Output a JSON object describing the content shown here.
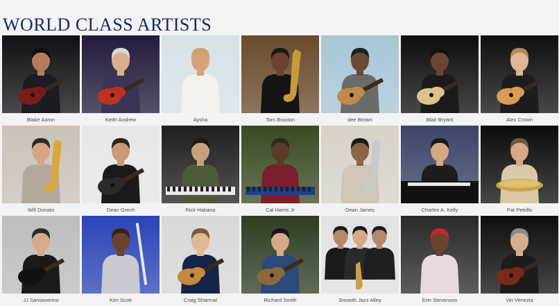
{
  "page": {
    "title": "WORLD CLASS ARTISTS"
  },
  "artists": [
    {
      "name": "Blake Aaron",
      "bg": "#111014",
      "shirt": "#1c1c22",
      "skin": "#b57d5a",
      "hair": "#111111",
      "prop": "guitar",
      "accent": "#7a1d1a"
    },
    {
      "name": "Keith Andrew",
      "bg": "#241a3d",
      "shirt": "#3a3456",
      "skin": "#d9b08d",
      "hair": "#d8d8d8",
      "prop": "guitar",
      "accent": "#c0301f"
    },
    {
      "name": "Aysha",
      "bg": "#d7e2e8",
      "shirt": "#f4f1ec",
      "skin": "#d6a27b",
      "hair": "#c9a56b",
      "prop": "none",
      "accent": "#f4f1ec"
    },
    {
      "name": "Tom Braxton",
      "bg": "#6a4a2c",
      "shirt": "#141414",
      "skin": "#6a4430",
      "hair": "#1a1a1a",
      "prop": "sax",
      "accent": "#c79a3a"
    },
    {
      "name": "dee Brown",
      "bg": "#a8c6d6",
      "shirt": "#6b6b6b",
      "skin": "#6b4a35",
      "hair": "#222222",
      "prop": "guitar",
      "accent": "#c08a4a"
    },
    {
      "name": "Blair Bryant",
      "bg": "#0d0d0d",
      "shirt": "#1b1b1b",
      "skin": "#6a4531",
      "hair": "#111111",
      "prop": "guitar",
      "accent": "#d9c38a"
    },
    {
      "name": "Alex Crown",
      "bg": "#0f0f0f",
      "shirt": "#1d1d1d",
      "skin": "#e0b794",
      "hair": "#b08a5a",
      "prop": "guitar",
      "accent": "#d89a55"
    },
    {
      "name": "Will Donato",
      "bg": "#c9c2b8",
      "shirt": "#b3a89c",
      "skin": "#d4a784",
      "hair": "#2a2a2a",
      "prop": "sax",
      "accent": "#d6a838"
    },
    {
      "name": "Dean Grech",
      "bg": "#e8e8e8",
      "shirt": "#1a1a1a",
      "skin": "#c99a76",
      "hair": "#2a2420",
      "prop": "guitar",
      "accent": "#2a2a2a"
    },
    {
      "name": "Rick Habana",
      "bg": "#1f1f1f",
      "shirt": "#4d5a3a",
      "skin": "#c9a07e",
      "hair": "#1a1a1a",
      "prop": "keys",
      "accent": "#e8e8e8"
    },
    {
      "name": "Cal Harris Jr",
      "bg": "#3b4a22",
      "shirt": "#7a1f2b",
      "skin": "#5a3b2a",
      "hair": "#2a2a2a",
      "prop": "keys",
      "accent": "#1f3f8a"
    },
    {
      "name": "Dean James",
      "bg": "#d8d2c8",
      "shirt": "#cfc6b8",
      "skin": "#8a6448",
      "hair": "#1a1a1a",
      "prop": "sax",
      "accent": "#c9c9c9"
    },
    {
      "name": "Charles A. Kelly",
      "bg": "#3c4468",
      "shirt": "#1d1d1d",
      "skin": "#d4a882",
      "hair": "#1a1a1a",
      "prop": "piano",
      "accent": "#111111"
    },
    {
      "name": "Pat Petrillo",
      "bg": "#0c0c0c",
      "shirt": "#d9c9a8",
      "skin": "#d6a883",
      "hair": "#6a5a4a",
      "prop": "drum",
      "accent": "#c9a04a"
    },
    {
      "name": "JJ Sansaverino",
      "bg": "#bdbdbd",
      "shirt": "#1a1a1a",
      "skin": "#d6aa8a",
      "hair": "#2a2a2a",
      "prop": "guitar",
      "accent": "#111111"
    },
    {
      "name": "Kim Scott",
      "bg": "#2a44b8",
      "shirt": "#c9c9d1",
      "skin": "#6a4230",
      "hair": "#3a2418",
      "prop": "flute",
      "accent": "#e6e6e6"
    },
    {
      "name": "Craig Sharmat",
      "bg": "#d8d8d8",
      "shirt": "#16234a",
      "skin": "#e0b797",
      "hair": "#7a5a3a",
      "prop": "guitar",
      "accent": "#c5883e"
    },
    {
      "name": "Richard Smith",
      "bg": "#2f3d22",
      "shirt": "#2a4a7a",
      "skin": "#d4aa88",
      "hair": "#1a1a1a",
      "prop": "guitar",
      "accent": "#8a6a3a"
    },
    {
      "name": "Smooth Jazz Alley",
      "bg": "#e2e2e2",
      "shirt": "#1a1a1a",
      "skin": "#b58a6a",
      "hair": "#1a1a1a",
      "prop": "trio",
      "accent": "#c9a04a"
    },
    {
      "name": "Erin Stevenson",
      "bg": "#2a2a2a",
      "shirt": "#e8d8e0",
      "skin": "#6a432f",
      "hair": "#c02a2a",
      "prop": "none",
      "accent": "#d03030"
    },
    {
      "name": "Vin Venezia",
      "bg": "#0e0e0e",
      "shirt": "#1c1c1c",
      "skin": "#d8ae8c",
      "hair": "#8a8a8a",
      "prop": "guitar",
      "accent": "#7a2a1a"
    }
  ]
}
